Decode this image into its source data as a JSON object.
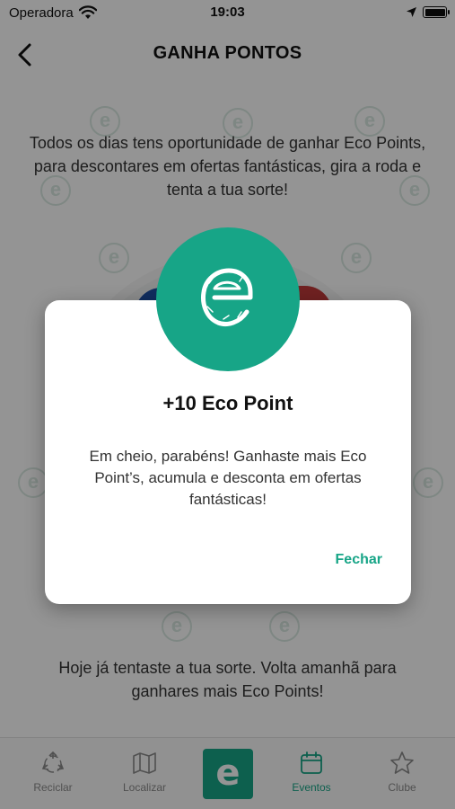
{
  "status_bar": {
    "carrier": "Operadora",
    "time": "19:03",
    "icons": [
      "wifi-icon",
      "location-arrow-icon",
      "battery-icon"
    ]
  },
  "header": {
    "title": "GANHA PONTOS",
    "back_icon": "chevron-left-icon"
  },
  "content": {
    "intro": "Todos os dias tens oportunidade de ganhar Eco Points, para descontares em ofertas fantásticas, gira a roda e tenta a tua sorte!",
    "footer": "Hoje já tentaste a tua sorte. Volta amanhã para ganhares mais Eco Points!"
  },
  "modal": {
    "icon": "eco-logo-icon",
    "title": "+10 Eco Point",
    "message": "Em cheio, parabéns! Ganhaste mais Eco Point’s, acumula e desconta em ofertas fantásticas!",
    "close_label": "Fechar"
  },
  "tab_bar": {
    "items": [
      {
        "label": "Reciclar",
        "icon": "recycle-icon"
      },
      {
        "label": "Localizar",
        "icon": "map-icon"
      },
      {
        "label": "",
        "icon": "eco-logo-icon",
        "letter": "e"
      },
      {
        "label": "Eventos",
        "icon": "calendar-icon",
        "active": true
      },
      {
        "label": "Clube",
        "icon": "star-icon"
      }
    ]
  },
  "colors": {
    "accent": "#17a587",
    "overlay": "rgba(0,0,0,0.42)"
  }
}
